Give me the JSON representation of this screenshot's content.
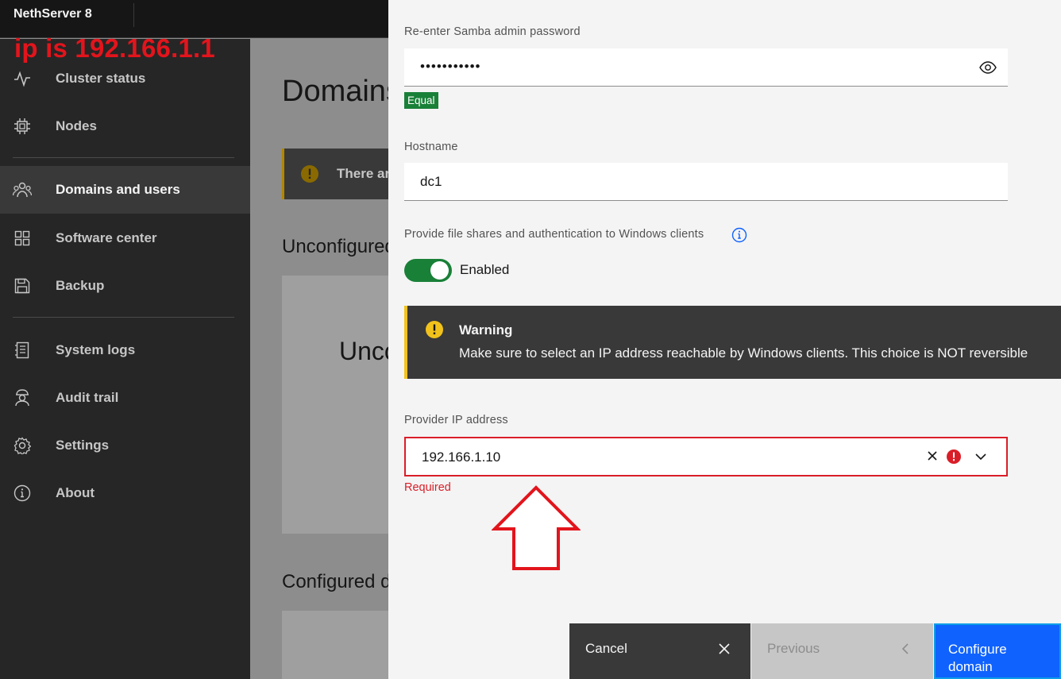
{
  "header": {
    "brand": "NethServer 8"
  },
  "annotation": {
    "text": "ip is 192.166.1.1",
    "color": "#e3141c"
  },
  "sidebar": {
    "items": [
      {
        "label": "Cluster status",
        "icon": "activity-icon"
      },
      {
        "label": "Nodes",
        "icon": "chip-icon"
      },
      {
        "label": "Domains and users",
        "icon": "users-icon",
        "active": true
      },
      {
        "label": "Software center",
        "icon": "apps-icon"
      },
      {
        "label": "Backup",
        "icon": "save-icon"
      },
      {
        "label": "System logs",
        "icon": "logs-icon"
      },
      {
        "label": "Audit trail",
        "icon": "audit-icon"
      },
      {
        "label": "Settings",
        "icon": "gear-icon"
      },
      {
        "label": "About",
        "icon": "info-icon"
      }
    ]
  },
  "main": {
    "title": "Domains and users",
    "notification": "There are",
    "unconfigured_section": "Unconfigured",
    "unconfigured_tile": "Unconfigured",
    "configured_section": "Configured domains"
  },
  "panel": {
    "reenter_password_label": "Re-enter Samba admin password",
    "reenter_password_value": "•••••••••••",
    "password_match_tag": "Equal",
    "hostname_label": "Hostname",
    "hostname_value": "dc1",
    "file_shares_label": "Provide file shares and authentication to Windows clients",
    "toggle_state": "Enabled",
    "warning_title": "Warning",
    "warning_body": "Make sure to select an IP address reachable by Windows clients. This choice is NOT reversible",
    "provider_ip_label": "Provider IP address",
    "provider_ip_value": "192.166.1.10",
    "provider_ip_error": "Required"
  },
  "footer": {
    "cancel_label": "Cancel",
    "previous_label": "Previous",
    "configure_label": "Configure domain"
  },
  "colors": {
    "success": "#198038",
    "error": "#da1e28",
    "primary": "#0f62fe",
    "warning_accent": "#f1c21b"
  }
}
